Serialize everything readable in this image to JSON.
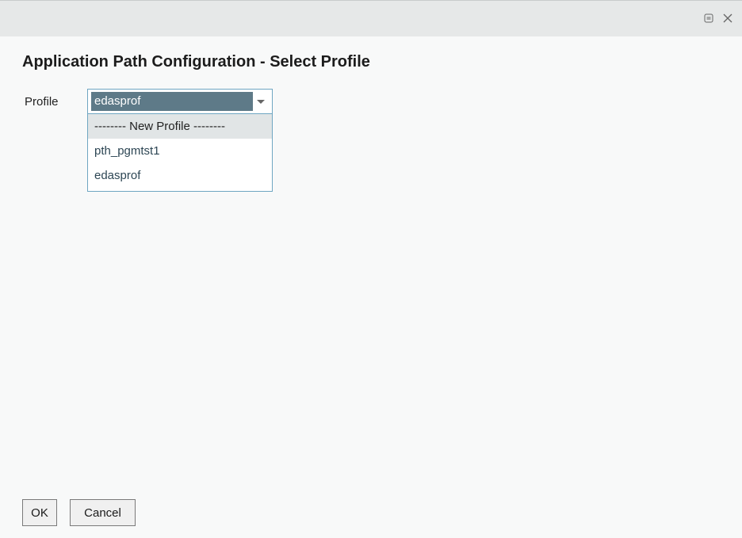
{
  "window": {
    "restore_icon": "restore-window-icon",
    "close_icon": "close-icon"
  },
  "page": {
    "title": "Application Path Configuration - Select Profile"
  },
  "form": {
    "profile_label": "Profile",
    "profile_selected": "edasprof",
    "profile_options": [
      "-------- New Profile --------",
      "pth_pgmtst1",
      "edasprof"
    ],
    "highlighted_option_index": 0
  },
  "footer": {
    "ok_label": "OK",
    "cancel_label": "Cancel"
  },
  "colors": {
    "selected_value_bg": "#5e7a88",
    "select_border": "#6fa6c2",
    "highlight_bg": "#e1e5e6"
  }
}
